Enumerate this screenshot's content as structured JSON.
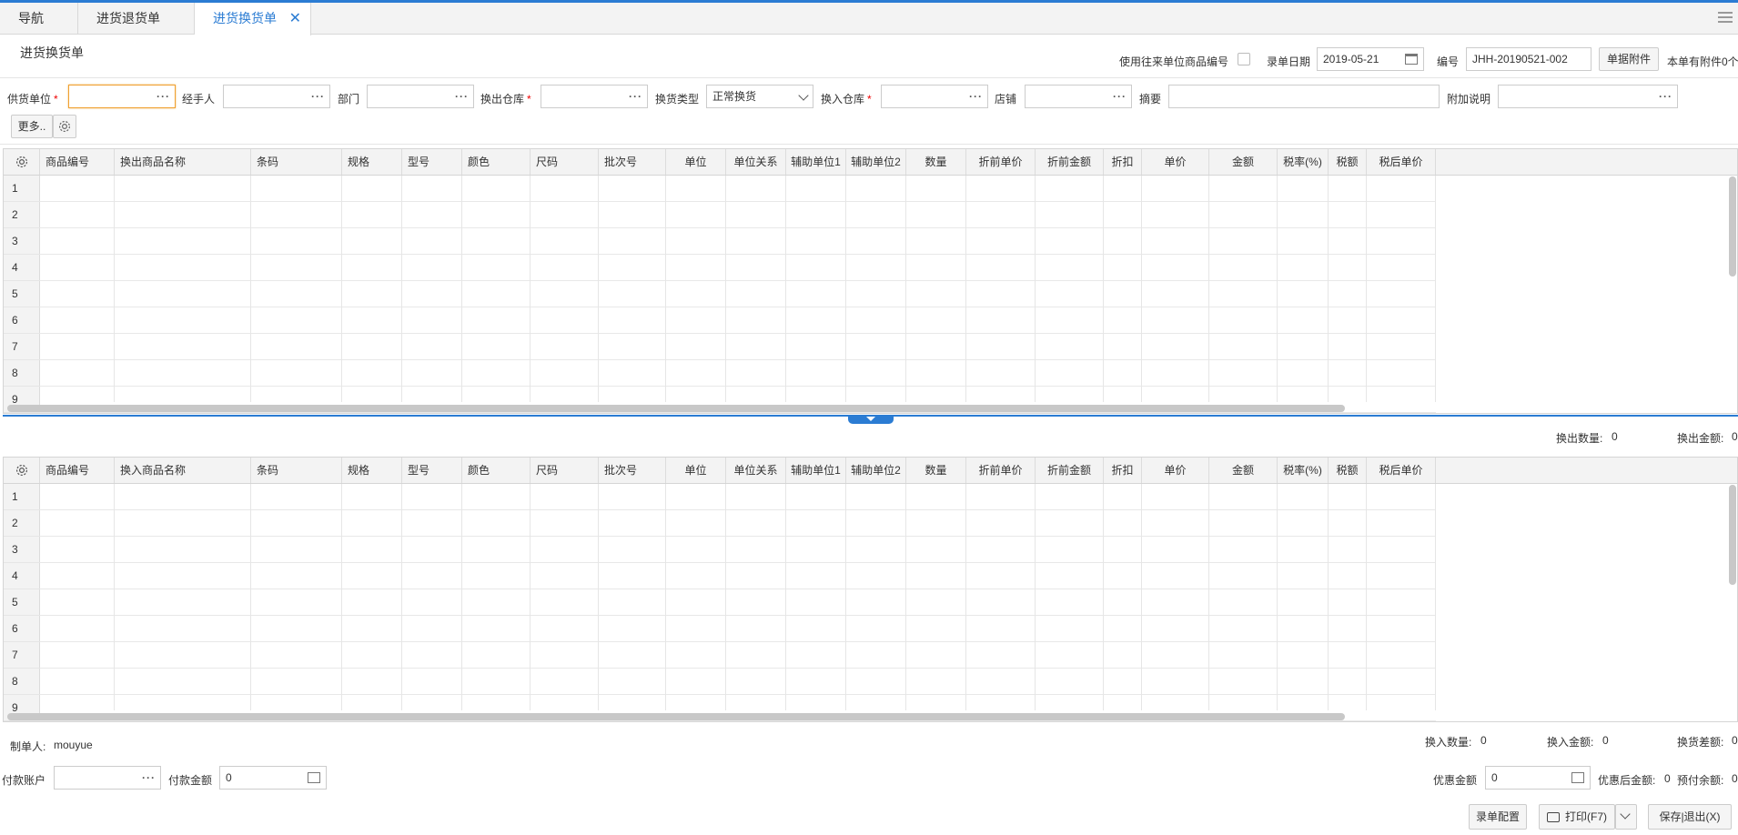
{
  "tabs": [
    {
      "label": "导航"
    },
    {
      "label": "进货退货单"
    },
    {
      "label": "进货换货单",
      "active": true
    }
  ],
  "page_title": "进货换货单",
  "header_right": {
    "use_partner_code_label": "使用往来单位商品编号",
    "entry_date_label": "录单日期",
    "entry_date_value": "2019-05-21",
    "number_label": "编号",
    "number_value": "JHH-20190521-002",
    "attachment_button": "单据附件",
    "attachment_info": "本单有附件0个"
  },
  "form": {
    "supplier_label": "供货单位",
    "handler_label": "经手人",
    "department_label": "部门",
    "out_warehouse_label": "换出仓库",
    "exchange_type_label": "换货类型",
    "exchange_type_value": "正常换货",
    "in_warehouse_label": "换入仓库",
    "shop_label": "店铺",
    "summary_label": "摘要",
    "extra_note_label": "附加说明",
    "more_button": "更多..",
    "required_mark": "*"
  },
  "grid_out": {
    "columns": [
      "商品编号",
      "换出商品名称",
      "条码",
      "规格",
      "型号",
      "颜色",
      "尺码",
      "批次号",
      "单位",
      "单位关系",
      "辅助单位1",
      "辅助单位2",
      "数量",
      "折前单价",
      "折前金额",
      "折扣",
      "单价",
      "金额",
      "税率(%)",
      "税额",
      "税后单价"
    ],
    "rows": [
      "1",
      "2",
      "3",
      "4",
      "5",
      "6",
      "7",
      "8",
      "9"
    ]
  },
  "out_summary": {
    "qty_label": "换出数量:",
    "qty_value": "0",
    "amount_label": "换出金额:",
    "amount_value": "0"
  },
  "grid_in": {
    "columns": [
      "商品编号",
      "换入商品名称",
      "条码",
      "规格",
      "型号",
      "颜色",
      "尺码",
      "批次号",
      "单位",
      "单位关系",
      "辅助单位1",
      "辅助单位2",
      "数量",
      "折前单价",
      "折前金额",
      "折扣",
      "单价",
      "金额",
      "税率(%)",
      "税额",
      "税后单价"
    ],
    "rows": [
      "1",
      "2",
      "3",
      "4",
      "5",
      "6",
      "7",
      "8",
      "9"
    ]
  },
  "footer": {
    "maker_label": "制单人:",
    "maker_value": "mouyue",
    "in_qty_label": "换入数量:",
    "in_qty_value": "0",
    "in_amount_label": "换入金额:",
    "in_amount_value": "0",
    "diff_label": "换货差额:",
    "diff_value": "0",
    "pay_account_label": "付款账户",
    "pay_amount_label": "付款金额",
    "pay_amount_value": "0",
    "discount_label": "优惠金额",
    "discount_value": "0",
    "after_discount_label": "优惠后金额:",
    "after_discount_value": "0",
    "prepaid_label": "预付余额:",
    "prepaid_value": "0",
    "config_button": "录单配置",
    "print_button": "打印(F7)",
    "save_button": "保存|退出(X)"
  },
  "colors": {
    "accent": "#2b7cd3",
    "required": "#e00000",
    "focus_border": "#f0a030"
  }
}
